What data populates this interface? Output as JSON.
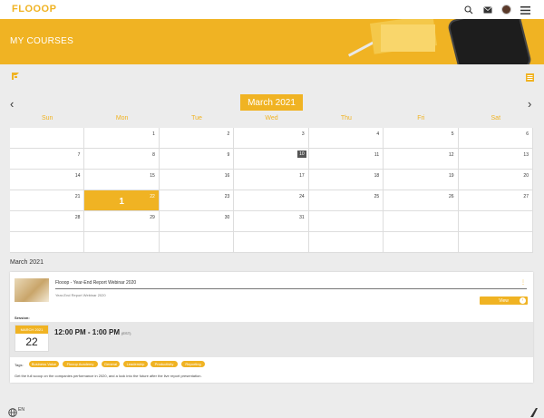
{
  "header": {
    "logo": "FLOOOP",
    "icons": [
      "search-icon",
      "mail-icon",
      "avatar",
      "hamburger-menu-icon"
    ]
  },
  "banner": {
    "title": "MY COURSES"
  },
  "toolbar": {
    "left_icon": "flooop-mark-icon",
    "right_icon": "calendar-list-icon"
  },
  "calendar": {
    "month_label": "March 2021",
    "weekdays": [
      "Sun",
      "Mon",
      "Tue",
      "Wed",
      "Thu",
      "Fri",
      "Sat"
    ],
    "weeks": [
      [
        "",
        "1",
        "2",
        "3",
        "4",
        "5",
        "6"
      ],
      [
        "7",
        "8",
        "9",
        "10",
        "11",
        "12",
        "13"
      ],
      [
        "14",
        "15",
        "16",
        "17",
        "18",
        "19",
        "20"
      ],
      [
        "21",
        "22",
        "23",
        "24",
        "25",
        "26",
        "27"
      ],
      [
        "28",
        "29",
        "30",
        "31",
        "",
        "",
        ""
      ],
      [
        "",
        "",
        "",
        "",
        "",
        "",
        ""
      ]
    ],
    "today": "10",
    "event_day": "22",
    "event_count": "1"
  },
  "events_section": {
    "label": "March 2021"
  },
  "course": {
    "title": "Flooop - Year-End Report Webinar 2020",
    "subtitle": "Year-End Report Webinar 2020",
    "view_label": "View",
    "session_label": "Session:",
    "date_month": "MARCH 2021",
    "date_day": "22",
    "time_range": "12:00 PM - 1:00 PM",
    "timezone": "(EST)",
    "tags_label": "Tags:",
    "tags": [
      "Business Value",
      "Flooop Academy",
      "General",
      "Leadership",
      "Productivity",
      "Reporting"
    ],
    "description": "Get the full scoop on the companies performance in 2020, and a look into the future after the live report presentation."
  },
  "footer": {
    "language": "EN"
  },
  "colors": {
    "accent": "#f0b323",
    "background": "#ececec"
  }
}
